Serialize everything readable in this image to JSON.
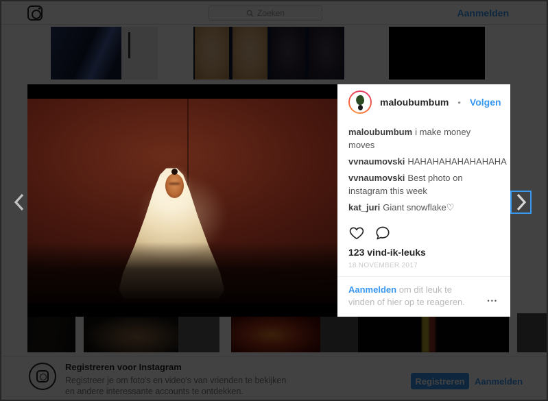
{
  "navbar": {
    "logo": "instagram",
    "search_placeholder": "Zoeken",
    "signin_label": "Aanmelden"
  },
  "modal": {
    "username": "maloubumbum",
    "separator": "•",
    "follow_label": "Volgen",
    "photo_description": "person seated under a white tulle veil, face lit, against a dark red wall",
    "comments": [
      {
        "user": "maloubumbum",
        "text": "i make money moves"
      },
      {
        "user": "vvnaumovski",
        "text": "HAHAHAHAHAHAHAHA"
      },
      {
        "user": "vvnaumovski",
        "text": "Best photo on instagram this week"
      },
      {
        "user": "kat_juri",
        "text": "Giant snowflake♡"
      }
    ],
    "likes_label": "123 vind-ik-leuks",
    "timestamp": "18 november 2017",
    "signin_prompt": {
      "link": "Aanmelden",
      "rest": " om dit leuk te vinden of hier op te reageren."
    },
    "more_options": "•••"
  },
  "footer": {
    "title": "Registreren voor Instagram",
    "description_line1": "Registreer je om foto's en video's van vrienden te bekijken",
    "description_line2": "en andere interessante accounts te ontdekken.",
    "register_label": "Registreren",
    "signin_label": "Aanmelden"
  },
  "colors": {
    "accent_blue": "#3897f0",
    "overlay": "rgba(0,0,0,0.74)"
  }
}
